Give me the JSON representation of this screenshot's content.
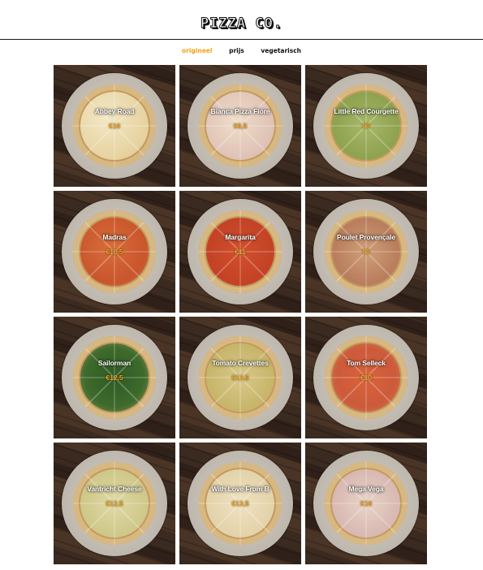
{
  "header": {
    "logo": "PIZZA CO."
  },
  "nav": {
    "items": [
      {
        "label": "origineel",
        "active": true
      },
      {
        "label": "prijs",
        "active": false
      },
      {
        "label": "vegetarisch",
        "active": false
      }
    ]
  },
  "menu": {
    "pizzas": [
      {
        "name": "Abbey Road",
        "price": "€10"
      },
      {
        "name": "Bianca Pizza Fiore",
        "price": "€8,5"
      },
      {
        "name": "Little Red Courgette",
        "price": "€9"
      },
      {
        "name": "Madras",
        "price": "€10,5"
      },
      {
        "name": "Margarita",
        "price": "€11"
      },
      {
        "name": "Poulet Provençale",
        "price": "€9"
      },
      {
        "name": "Sailorman",
        "price": "€12,5"
      },
      {
        "name": "Tomato Crevettes",
        "price": "€13,5"
      },
      {
        "name": "Tom Selleck",
        "price": "€10"
      },
      {
        "name": "Vantricht Cheese",
        "price": "€12,5"
      },
      {
        "name": "With Love From B",
        "price": "€13,5"
      },
      {
        "name": "Mega Vega",
        "price": "€10"
      }
    ]
  },
  "colors": {
    "accent": "#f5a315",
    "text": "#111111",
    "background": "#ffffff"
  }
}
